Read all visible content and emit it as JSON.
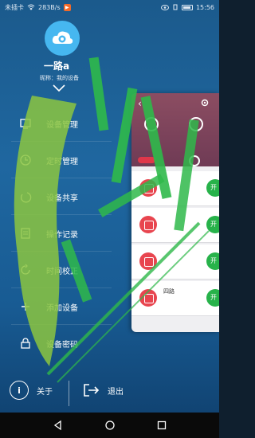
{
  "status": {
    "carrier": "未插卡",
    "speed": "283B/s",
    "time": "15:56"
  },
  "profile": {
    "name": "一路a",
    "nickname": "昵称：我的设备"
  },
  "menu": {
    "items": [
      {
        "label": "设备管理",
        "icon": "device-icon"
      },
      {
        "label": "定时管理",
        "icon": "clock-icon"
      },
      {
        "label": "设备共享",
        "icon": "share-icon"
      },
      {
        "label": "操作记录",
        "icon": "log-icon"
      },
      {
        "label": "时间校正",
        "icon": "time-sync-icon"
      },
      {
        "label": "添加设备",
        "icon": "add-device-icon"
      },
      {
        "label": "设备密码",
        "icon": "lock-icon"
      }
    ]
  },
  "footer": {
    "about": "关于",
    "about_glyph": "i",
    "logout": "退出"
  },
  "panel": {
    "toggle_on": "开",
    "row4_name": "四路"
  },
  "colors": {
    "drawer_bg": "#1f67a0",
    "avatar": "#46b7f0",
    "panel_header": "#8c4d62",
    "toggle_on": "#27b24a",
    "relay_icon": "#e8454f"
  }
}
